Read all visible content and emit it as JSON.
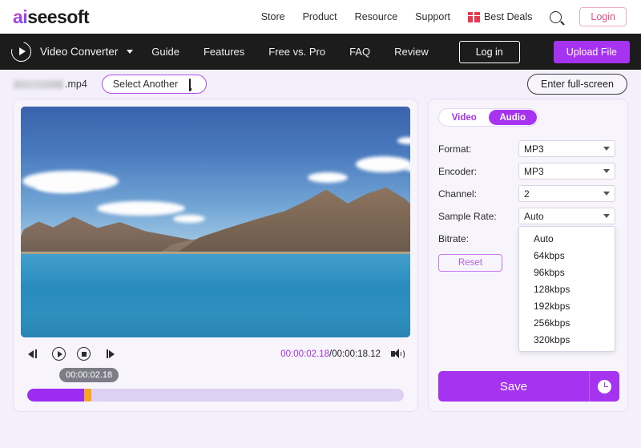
{
  "topbar": {
    "logo_prefix": "ai",
    "logo_suffix": "seesoft",
    "nav": [
      {
        "label": "Store"
      },
      {
        "label": "Product"
      },
      {
        "label": "Resource"
      },
      {
        "label": "Support"
      }
    ],
    "best_deals": "Best Deals",
    "gift_icon": "gift-icon",
    "search_icon": "search-icon",
    "login_label": "Login"
  },
  "darknav": {
    "brand_icon": "play-circle-icon",
    "brand_label": "Video Converter",
    "caret_icon": "chevron-down-icon",
    "links": [
      {
        "label": "Guide"
      },
      {
        "label": "Features"
      },
      {
        "label": "Free vs. Pro"
      },
      {
        "label": "FAQ"
      },
      {
        "label": "Review"
      }
    ],
    "login_label": "Log in",
    "upload_label": "Upload File"
  },
  "filebar": {
    "filename_extension": ".mp4",
    "filename_redacted": true,
    "select_another_label": "Select Another",
    "monitor_icon": "monitor-icon",
    "fullscreen_label": "Enter full-screen"
  },
  "player": {
    "preview_alt": "lake-and-mountains-video-frame",
    "controls": [
      {
        "name": "previous-frame-button",
        "icon": "rewind-icon"
      },
      {
        "name": "play-button",
        "icon": "play-circle-icon"
      },
      {
        "name": "stop-button",
        "icon": "stop-circle-icon"
      },
      {
        "name": "next-frame-button",
        "icon": "fast-forward-icon"
      }
    ],
    "current_time": "00:00:02.18",
    "time_separator": "/",
    "total_time": "00:00:18.12",
    "volume_icon": "volume-icon",
    "tooltip_time": "00:00:02.18",
    "progress_percent": 12,
    "progress_fill_color": "#9c2df0",
    "progress_handle_color": "#f5a623"
  },
  "settings": {
    "tabs": [
      {
        "label": "Video",
        "active": false
      },
      {
        "label": "Audio",
        "active": true
      }
    ],
    "fields": [
      {
        "label": "Format:",
        "value": "MP3"
      },
      {
        "label": "Encoder:",
        "value": "MP3"
      },
      {
        "label": "Channel:",
        "value": "2"
      },
      {
        "label": "Sample Rate:",
        "value": "Auto"
      },
      {
        "label": "Bitrate:",
        "value": "Auto"
      }
    ],
    "reset_label": "Reset",
    "bitrate_dropdown_open": true,
    "bitrate_options": [
      {
        "label": "Auto"
      },
      {
        "label": "64kbps"
      },
      {
        "label": "96kbps"
      },
      {
        "label": "128kbps"
      },
      {
        "label": "192kbps"
      },
      {
        "label": "256kbps"
      },
      {
        "label": "320kbps"
      }
    ],
    "save_label": "Save",
    "history_icon": "clock-icon"
  },
  "colors": {
    "accent_purple": "#a633f0",
    "page_background": "#f4f0fb",
    "panel_background": "#f7f4fc",
    "dark_nav": "#1c1c1c",
    "login_pink": "#ec4b87"
  }
}
